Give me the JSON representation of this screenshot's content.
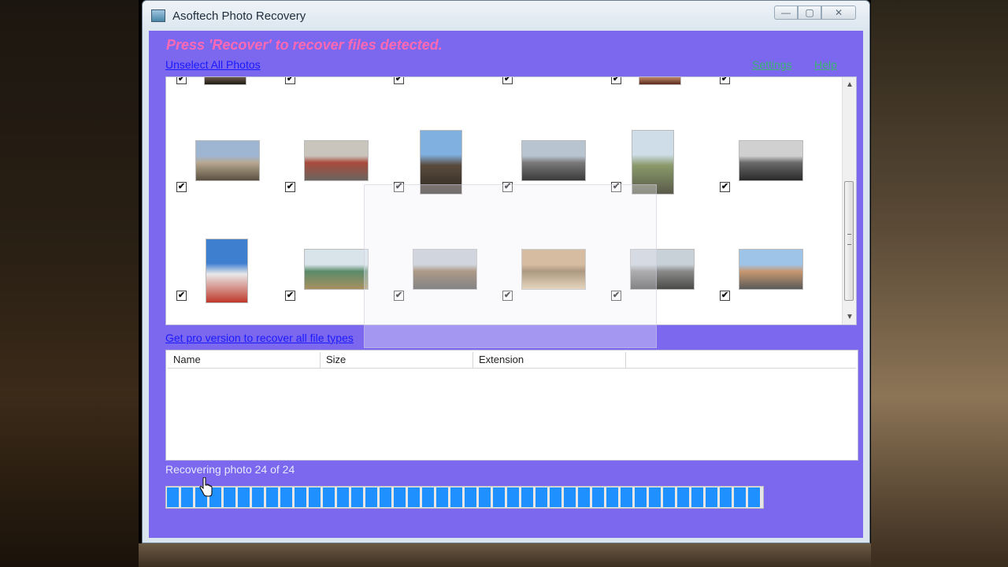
{
  "window": {
    "title": "Asoftech Photo Recovery",
    "controls": {
      "minimize": "—",
      "maximize": "▢",
      "close": "✕"
    }
  },
  "header": {
    "headline": "Press 'Recover' to recover files detected.",
    "unselect_link": "Unselect All Photos",
    "settings_link": "Settings",
    "help_link": "Help"
  },
  "photo_grid": {
    "checkbox_mark": "✔",
    "rows": [
      {
        "name": "row-1-partial",
        "items": [
          {
            "name": "photo-portrait-dark",
            "colors": [
              "#3a3026",
              "#6b5a48",
              "#1e1a16"
            ],
            "checked": true
          },
          {
            "name": "photo-partial-2",
            "colors": [],
            "checked": true
          },
          {
            "name": "photo-red-building",
            "colors": [
              "#8b3a2a",
              "#c0876a",
              "#5a2a1a"
            ],
            "checked": true
          },
          {
            "name": "photo-partial-4",
            "colors": [],
            "checked": true
          },
          {
            "name": "photo-partial-5",
            "colors": [],
            "checked": true
          },
          {
            "name": "photo-partial-6",
            "colors": [],
            "checked": true
          }
        ]
      },
      {
        "name": "row-2",
        "items": [
          {
            "name": "photo-brandenburg-gate",
            "colors": [
              "#9fb6d3",
              "#b8a890",
              "#5a5040"
            ],
            "checked": true
          },
          {
            "name": "photo-checkpoint-street",
            "colors": [
              "#c9c4bc",
              "#a84a3c",
              "#6a6660"
            ],
            "checked": true
          },
          {
            "name": "photo-church-tower",
            "colors": [
              "#7fb0e0",
              "#5a4a3c",
              "#2e2822"
            ],
            "checked": true
          },
          {
            "name": "photo-memorial-blocks",
            "colors": [
              "#b8c4d0",
              "#7a7a7a",
              "#3a3a3a"
            ],
            "checked": true
          },
          {
            "name": "photo-statue-monument",
            "colors": [
              "#cfdde8",
              "#8a9a6a",
              "#5a5a4a"
            ],
            "checked": true
          },
          {
            "name": "photo-city-aerial",
            "colors": [
              "#d0d0d0",
              "#6a6a6a",
              "#2a2a2a"
            ],
            "checked": true
          }
        ]
      },
      {
        "name": "row-3",
        "items": [
          {
            "name": "photo-tv-tower",
            "colors": [
              "#3f7fd0",
              "#e8e8e8",
              "#c0392b"
            ],
            "checked": true
          },
          {
            "name": "photo-green-building",
            "colors": [
              "#d8e4ea",
              "#5a8a6a",
              "#a89060"
            ],
            "checked": true
          },
          {
            "name": "photo-aerial-square",
            "colors": [
              "#c0c8d0",
              "#8a6a4a",
              "#4a4a4a"
            ],
            "checked": true
          },
          {
            "name": "photo-bear-mosaic",
            "colors": [
              "#c8a070",
              "#8a6a40",
              "#e0c8a0"
            ],
            "checked": true
          },
          {
            "name": "photo-reichstag",
            "colors": [
              "#c8d0d8",
              "#8a8a8a",
              "#4a4a48"
            ],
            "checked": true
          },
          {
            "name": "photo-apartment-block",
            "colors": [
              "#9ec4e8",
              "#c89870",
              "#5a5a5a"
            ],
            "checked": true
          }
        ]
      }
    ]
  },
  "pro_link": "Get pro version to recover all file types",
  "file_list": {
    "columns": [
      "Name",
      "Size",
      "Extension",
      ""
    ],
    "rows": []
  },
  "status": {
    "text": "Recovering photo 24 of 24",
    "progress": 1.0
  },
  "colors": {
    "client_bg": "#7b68ee",
    "headline": "#ff69b4",
    "link_blue": "#1a1aff",
    "link_green": "#3cb371",
    "progress_fill": "#1e90ff"
  }
}
